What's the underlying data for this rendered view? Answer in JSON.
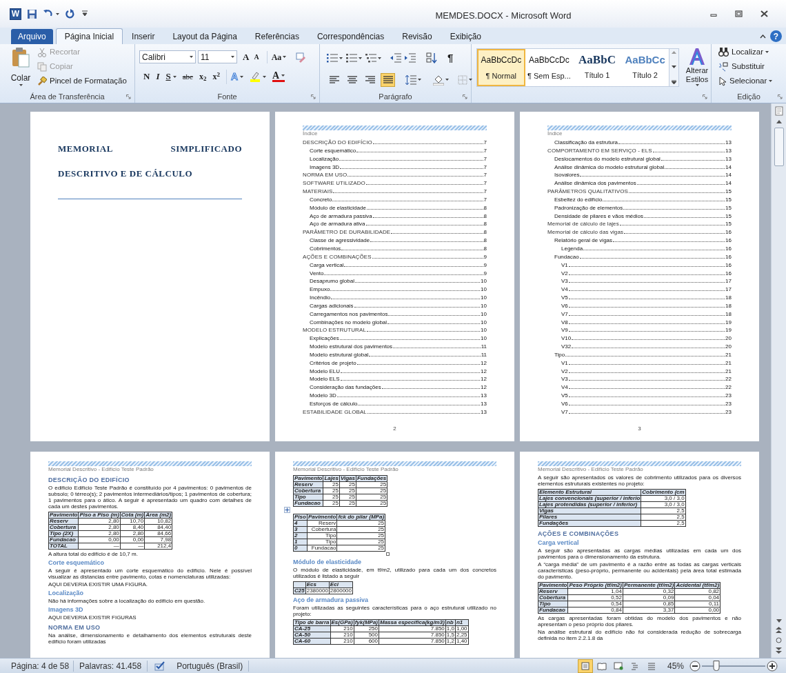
{
  "window": {
    "app_icon": "W",
    "title": "MEMDES.DOCX - Microsoft Word",
    "help": "?"
  },
  "tabs": [
    {
      "label": "Arquivo",
      "kind": "file",
      "selected": false
    },
    {
      "label": "Página Inicial",
      "kind": "tab",
      "selected": true
    },
    {
      "label": "Inserir",
      "kind": "tab",
      "selected": false
    },
    {
      "label": "Layout da Página",
      "kind": "tab",
      "selected": false
    },
    {
      "label": "Referências",
      "kind": "tab",
      "selected": false
    },
    {
      "label": "Correspondências",
      "kind": "tab",
      "selected": false
    },
    {
      "label": "Revisão",
      "kind": "tab",
      "selected": false
    },
    {
      "label": "Exibição",
      "kind": "tab",
      "selected": false
    }
  ],
  "ribbon": {
    "clipboard": {
      "group": "Área de Transferência",
      "paste": "Colar",
      "cut": {
        "label": "Recortar",
        "disabled": true
      },
      "copy": {
        "label": "Copiar",
        "disabled": true
      },
      "format_painter": {
        "label": "Pincel de Formatação",
        "disabled": false
      }
    },
    "font": {
      "group": "Fonte",
      "name": "Calibri",
      "size": "11",
      "grow": "A",
      "shrink": "A",
      "change_case": "Aa",
      "bold": "N",
      "italic": "I",
      "underline": "S",
      "strikethrough": "abc",
      "subscript": "x$_{2}$",
      "superscript": "x$^{2}$",
      "text_effects": "A",
      "font_color": "A"
    },
    "paragraph": {
      "group": "Parágrafo",
      "show_marks": "¶",
      "alignment": [
        {
          "kind": "left",
          "selected": false
        },
        {
          "kind": "center",
          "selected": false
        },
        {
          "kind": "right",
          "selected": false
        },
        {
          "kind": "justify",
          "selected": true
        }
      ]
    },
    "styles": {
      "items": [
        {
          "sample": "AaBbCcDc",
          "name": "¶ Normal",
          "kind": "normal",
          "selected": true
        },
        {
          "sample": "AaBbCcDc",
          "name": "¶ Sem Esp...",
          "kind": "normal",
          "selected": false
        },
        {
          "sample": "AaBbC",
          "name": "Título 1",
          "kind": "heading1",
          "selected": false
        },
        {
          "sample": "AaBbCc",
          "name": "Título 2",
          "kind": "heading2",
          "selected": false
        }
      ],
      "change_styles": "Alterar Estilos"
    },
    "editing": {
      "group": "Edição",
      "find": "Localizar",
      "replace": "Substituir",
      "select": "Selecionar"
    }
  },
  "document": {
    "pages": [
      {
        "blocks": [
          {
            "kind": "title",
            "lines": [
              "MEMORIAL SIMPLIFICADO",
              "DESCRITIVO E DE CÁLCULO"
            ]
          }
        ]
      },
      {
        "blocks": [
          {
            "kind": "running_header",
            "text": "Índice"
          },
          {
            "kind": "toc",
            "entries": [
              {
                "text": "DESCRIÇÃO DO EDIFÍCIO",
                "page": "7",
                "children": [
                  {
                    "text": "Corte esquemático",
                    "page": "7"
                  },
                  {
                    "text": "Localização",
                    "page": "7"
                  },
                  {
                    "text": "Imagens 3D",
                    "page": "7"
                  }
                ]
              },
              {
                "text": "NORMA EM USO",
                "page": "7"
              },
              {
                "text": "SOFTWARE UTILIZADO",
                "page": "7"
              },
              {
                "text": "MATERIAIS",
                "page": "7",
                "children": [
                  {
                    "text": "Concreto",
                    "page": "7"
                  },
                  {
                    "text": "Módulo de elasticidade",
                    "page": "8"
                  },
                  {
                    "text": "Aço de armadura passiva",
                    "page": "8"
                  },
                  {
                    "text": "Aço de armadura ativa",
                    "page": "8"
                  }
                ]
              },
              {
                "text": "PARÂMETRO DE DURABILIDADE",
                "page": "8",
                "children": [
                  {
                    "text": "Classe de agressividade",
                    "page": "8"
                  },
                  {
                    "text": "Cobrimentos",
                    "page": "8"
                  }
                ]
              },
              {
                "text": "AÇÕES E COMBINAÇÕES",
                "page": "9",
                "children": [
                  {
                    "text": "Carga vertical",
                    "page": "9"
                  },
                  {
                    "text": "Vento",
                    "page": "9"
                  },
                  {
                    "text": "Desaprumo global",
                    "page": "10"
                  },
                  {
                    "text": "Empuxo",
                    "page": "10"
                  },
                  {
                    "text": "Incêndio",
                    "page": "10"
                  },
                  {
                    "text": "Cargas adicionais",
                    "page": "10"
                  },
                  {
                    "text": "Carregamentos nos pavimentos",
                    "page": "10"
                  },
                  {
                    "text": "Combinações no modelo global",
                    "page": "10"
                  }
                ]
              },
              {
                "text": "MODELO ESTRUTURAL",
                "page": "10",
                "children": [
                  {
                    "text": "Explicações",
                    "page": "10"
                  },
                  {
                    "text": "Modelo estrutural dos pavimentos",
                    "page": "11"
                  },
                  {
                    "text": "Modelo estrutural global",
                    "page": "11"
                  },
                  {
                    "text": "Critérios de projeto",
                    "page": "12"
                  },
                  {
                    "text": "Modelo ELU",
                    "page": "12"
                  },
                  {
                    "text": "Modelo ELS",
                    "page": "12"
                  },
                  {
                    "text": "Consideração das fundações",
                    "page": "12"
                  },
                  {
                    "text": "Modelo 3D",
                    "page": "13"
                  },
                  {
                    "text": "Esforços de cálculo",
                    "page": "13"
                  }
                ]
              },
              {
                "text": "ESTABILIDADE GLOBAL",
                "page": "13"
              }
            ]
          },
          {
            "kind": "page_number",
            "text": "2"
          }
        ]
      },
      {
        "blocks": [
          {
            "kind": "running_header",
            "text": "Índice"
          },
          {
            "kind": "toc",
            "entries": [
              {
                "children": [
                  {
                    "text": "Classificação da estrutura",
                    "page": "13"
                  }
                ]
              },
              {
                "text": "COMPORTAMENTO EM SERVIÇO - ELS",
                "page": "13",
                "children": [
                  {
                    "text": "Deslocamentos do modelo estrutural global",
                    "page": "13"
                  },
                  {
                    "text": "Análise dinâmica do modelo estrutural global",
                    "page": "14"
                  },
                  {
                    "text": "Isovalores",
                    "page": "14"
                  },
                  {
                    "text": "Análise dinâmica dos pavimentos",
                    "page": "14"
                  }
                ]
              },
              {
                "text": "PARÂMETROS QUALITATIVOS",
                "page": "15",
                "children": [
                  {
                    "text": "Esbeltez do edifício",
                    "page": "15"
                  },
                  {
                    "text": "Padronização de elementos",
                    "page": "15"
                  },
                  {
                    "text": "Densidade de pilares e vãos médios",
                    "page": "15"
                  }
                ]
              },
              {
                "text": "Memorial de cálculo de lajes",
                "page": "15"
              },
              {
                "text": "Memorial de cálculo das vigas",
                "page": "16",
                "children": [
                  {
                    "text": "Relatório geral de vigas",
                    "page": "16",
                    "children": [
                      {
                        "text": "Legenda",
                        "page": "16"
                      }
                    ]
                  },
                  {
                    "text": "Fundacao",
                    "page": "16",
                    "children": [
                      {
                        "text": "V1",
                        "page": "16"
                      },
                      {
                        "text": "V2",
                        "page": "16"
                      },
                      {
                        "text": "V3",
                        "page": "17"
                      },
                      {
                        "text": "V4",
                        "page": "17"
                      },
                      {
                        "text": "V5",
                        "page": "18"
                      },
                      {
                        "text": "V6",
                        "page": "18"
                      },
                      {
                        "text": "V7",
                        "page": "18"
                      },
                      {
                        "text": "V8",
                        "page": "19"
                      },
                      {
                        "text": "V9",
                        "page": "19"
                      },
                      {
                        "text": "V10",
                        "page": "20"
                      },
                      {
                        "text": "V32",
                        "page": "20"
                      }
                    ]
                  },
                  {
                    "text": "Tipo",
                    "page": "21",
                    "children": [
                      {
                        "text": "V1",
                        "page": "21"
                      },
                      {
                        "text": "V2",
                        "page": "21"
                      },
                      {
                        "text": "V3",
                        "page": "22"
                      },
                      {
                        "text": "V4",
                        "page": "22"
                      },
                      {
                        "text": "V5",
                        "page": "23"
                      },
                      {
                        "text": "V6",
                        "page": "23"
                      },
                      {
                        "text": "V7",
                        "page": "23"
                      }
                    ]
                  }
                ]
              }
            ]
          },
          {
            "kind": "page_number",
            "text": "3"
          }
        ]
      },
      {
        "blocks": [
          {
            "kind": "running_header",
            "text": "Memorial Descritivo - Edifício Teste Padrão"
          },
          {
            "kind": "heading",
            "text": "DESCRIÇÃO DO EDIFÍCIO"
          },
          {
            "kind": "paragraph",
            "text": "O edifício Edifício Teste Padrão é constituído por 4 pavimentos: 0 pavimentos de subsolo; 0 térreo(s); 2 pavimentos intermediários/tipos; 1 pavimentos de cobertura; 1 pavimentos para o ático. A seguir é apresentado um quadro com detalhes de cada um destes pavimentos."
          },
          {
            "kind": "table",
            "show_handles": false,
            "columns": [
              "Pavimento",
              "Piso a Piso (m)",
              "Cota (m)",
              "Área (m2)"
            ],
            "rows": [
              [
                "Reserv",
                "2,80",
                "10,70",
                "10,82"
              ],
              [
                "Cobertura",
                "2,80",
                "8,40",
                "84,40"
              ],
              [
                "Tipo (2X)",
                "2,80",
                "2,80",
                "84,66"
              ],
              [
                "Fundacao",
                "0,00",
                "0,00",
                "7,98"
              ],
              [
                "TOTAL",
                "—",
                "—",
                "212,4"
              ]
            ]
          },
          {
            "kind": "paragraph",
            "text": "A altura total do edifício é de 10,7 m."
          },
          {
            "kind": "subheading",
            "text": "Corte esquemático"
          },
          {
            "kind": "paragraph",
            "text": "A seguir é apresentado um corte esquemático do edifício. Nele é possível visualizar as distancias entre pavimento, cotas e nomenclaturas utilizadas:"
          },
          {
            "kind": "paragraph",
            "text": "AQUI DEVERIA EXISTIR UMA FIGURA."
          },
          {
            "kind": "subheading",
            "text": "Localização"
          },
          {
            "kind": "paragraph",
            "text": "Não há informações sobre a localização do edifício em questão."
          },
          {
            "kind": "subheading",
            "text": "Imagens 3D"
          },
          {
            "kind": "paragraph",
            "text": "AQUI DEVERIA EXISTIR FIGURAS"
          },
          {
            "kind": "heading",
            "text": "NORMA EM USO"
          },
          {
            "kind": "paragraph",
            "text": "Na análise, dimensionamento e detalhamento dos elementos estruturais deste edifício foram utilizadas"
          }
        ]
      },
      {
        "blocks": [
          {
            "kind": "running_header",
            "text": "Memorial Descritivo - Edifício Teste Padrão"
          },
          {
            "kind": "table",
            "show_handles": false,
            "columns": [
              "Pavimento",
              "Lajes",
              "Vigas",
              "Fundações"
            ],
            "rows": [
              [
                "Reserv",
                "25",
                "25",
                "25"
              ],
              [
                "Cobertura",
                "25",
                "25",
                "25"
              ],
              [
                "Tipo",
                "25",
                "25",
                "25"
              ],
              [
                "Fundacao",
                "25",
                "25",
                "25"
              ]
            ]
          },
          {
            "kind": "table",
            "show_handles": true,
            "columns": [
              "Piso",
              "Pavimento",
              "fck do pilar (MPa)"
            ],
            "rows": [
              [
                "4",
                "Reserv",
                "25"
              ],
              [
                "3",
                "Cobertura",
                "25"
              ],
              [
                "2",
                "Tipo",
                "25"
              ],
              [
                "1",
                "Tipo",
                "25"
              ],
              [
                "0",
                "Fundacao",
                "25"
              ]
            ]
          },
          {
            "kind": "subheading",
            "text": "Módulo de elasticidade"
          },
          {
            "kind": "paragraph",
            "text": "O módulo de elasticidade, em tf/m2, utilizado para cada um dos concretos utilizados é listado a seguir"
          },
          {
            "kind": "table",
            "show_handles": false,
            "columns": [
              "",
              "Ecs",
              "Eci"
            ],
            "rows": [
              [
                "C25",
                "2380000",
                "2800000"
              ]
            ]
          },
          {
            "kind": "subheading",
            "text": "Aço de armadura passiva"
          },
          {
            "kind": "paragraph",
            "text": "Foram utilizadas as seguintes características para o aço estrutural utilizado no projeto:"
          },
          {
            "kind": "table",
            "show_handles": false,
            "columns": [
              "Tipo de barra",
              "Es(GPa)",
              "fyk(MPa)",
              "Massa específica(kg/m3)",
              "nb",
              "n1"
            ],
            "rows": [
              [
                "CA-25",
                "210",
                "250",
                "7.850",
                "1,0",
                "1,00"
              ],
              [
                "CA-50",
                "210",
                "500",
                "7.850",
                "1,5",
                "2,25"
              ],
              [
                "CA-60",
                "210",
                "600",
                "7.850",
                "1,2",
                "1,40"
              ]
            ]
          }
        ]
      },
      {
        "blocks": [
          {
            "kind": "running_header",
            "text": "Memorial Descritivo - Edifício Teste Padrão"
          },
          {
            "kind": "paragraph",
            "text": "A seguir são apresentados os valores de cobrimento utilizados para os diversos elementos estruturais existentes no projeto:"
          },
          {
            "kind": "table",
            "show_handles": false,
            "columns": [
              "Elemento Estrutural",
              "Cobrimento (cm"
            ],
            "rows": [
              [
                "Lajes convencionais (superior / inferio",
                "3,0 / 3,0"
              ],
              [
                "Lajes protendidas (superior / inferior)",
                "3,0 / 3,0"
              ],
              [
                "Vigas",
                "2,5"
              ],
              [
                "Pilares",
                "2,5"
              ],
              [
                "Fundações",
                "2,5"
              ]
            ]
          },
          {
            "kind": "heading",
            "text": "AÇÕES E COMBINAÇÕES"
          },
          {
            "kind": "subheading",
            "text": "Carga vertical"
          },
          {
            "kind": "paragraph",
            "text": "A seguir são apresentadas as cargas médias utilizadas em cada um dos pavimentos para o dimensionamento da estrutura."
          },
          {
            "kind": "paragraph",
            "text": "A “carga média” de um pavimento é a razão entre as todas as cargas verticais características (peso-próprio, permanente ou acidentais) pela área total estimada do pavimento."
          },
          {
            "kind": "table",
            "show_handles": false,
            "columns": [
              "Pavimento",
              "Peso Próprio (tf/m2)",
              "Permanente (tf/m2)",
              "Acidental (tf/m2)"
            ],
            "rows": [
              [
                "Reserv",
                "1,04",
                "0,32",
                "0,82"
              ],
              [
                "Cobertura",
                "0,52",
                "0,09",
                "0,04"
              ],
              [
                "Tipo",
                "0,54",
                "0,85",
                "0,11"
              ],
              [
                "Fundacao",
                "0,84",
                "3,37",
                "0,00"
              ]
            ]
          },
          {
            "kind": "paragraph",
            "text": "As cargas apresentadas foram obtidas do modelo dos pavimentos e não apresentam o peso próprio dos pilares."
          },
          {
            "kind": "paragraph",
            "text": "Na análise estrutural do edifício não foi considerada redução de sobrecarga definida no item 2.2.1.8 da"
          }
        ]
      }
    ]
  },
  "status_bar": {
    "page": "Página: 4 de 58",
    "words": "Palavras: 41.458",
    "language": "Português (Brasil)",
    "views": [
      {
        "kind": "print_layout",
        "selected": true
      },
      {
        "kind": "full_screen",
        "selected": false
      },
      {
        "kind": "web_layout",
        "selected": false
      },
      {
        "kind": "outline",
        "selected": false
      },
      {
        "kind": "draft",
        "selected": false
      }
    ],
    "zoom": {
      "reading": "45%",
      "level": 0.23
    }
  }
}
